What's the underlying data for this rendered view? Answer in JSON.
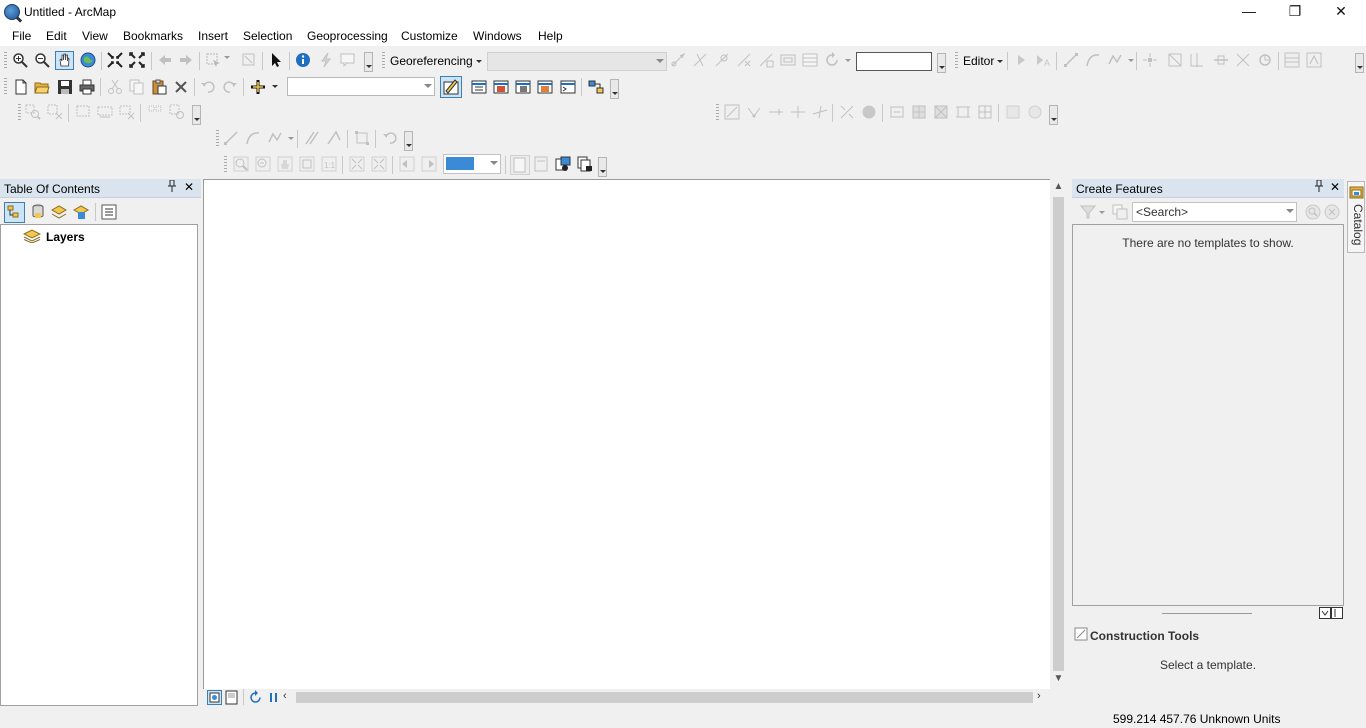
{
  "window": {
    "title": "Untitled - ArcMap",
    "minimize_glyph": "—",
    "restore_glyph": "❐",
    "close_glyph": "✕"
  },
  "menu": {
    "items": [
      "File",
      "Edit",
      "View",
      "Bookmarks",
      "Insert",
      "Selection",
      "Geoprocessing",
      "Customize",
      "Windows",
      "Help"
    ]
  },
  "toolbars": {
    "georeferencing_label": "Georeferencing",
    "editor_label": "Editor",
    "scale_value": "",
    "layer_combo_value": "",
    "georef_layer_value": ""
  },
  "toc": {
    "title": "Table Of Contents",
    "pin_glyph": "📌",
    "close_glyph": "✕",
    "root_label": "Layers"
  },
  "create_features": {
    "title": "Create Features",
    "search_placeholder": "<Search>",
    "empty_message": "There are no templates to show.",
    "construction_title": "Construction Tools",
    "construction_message": "Select a template."
  },
  "catalog": {
    "tab_label": "Catalog"
  },
  "status": {
    "coordinates": "599.214  457.76 Unknown Units"
  },
  "colors": {
    "panel_header": "#d9e4ef",
    "accent_blue": "#1f6fc0"
  }
}
